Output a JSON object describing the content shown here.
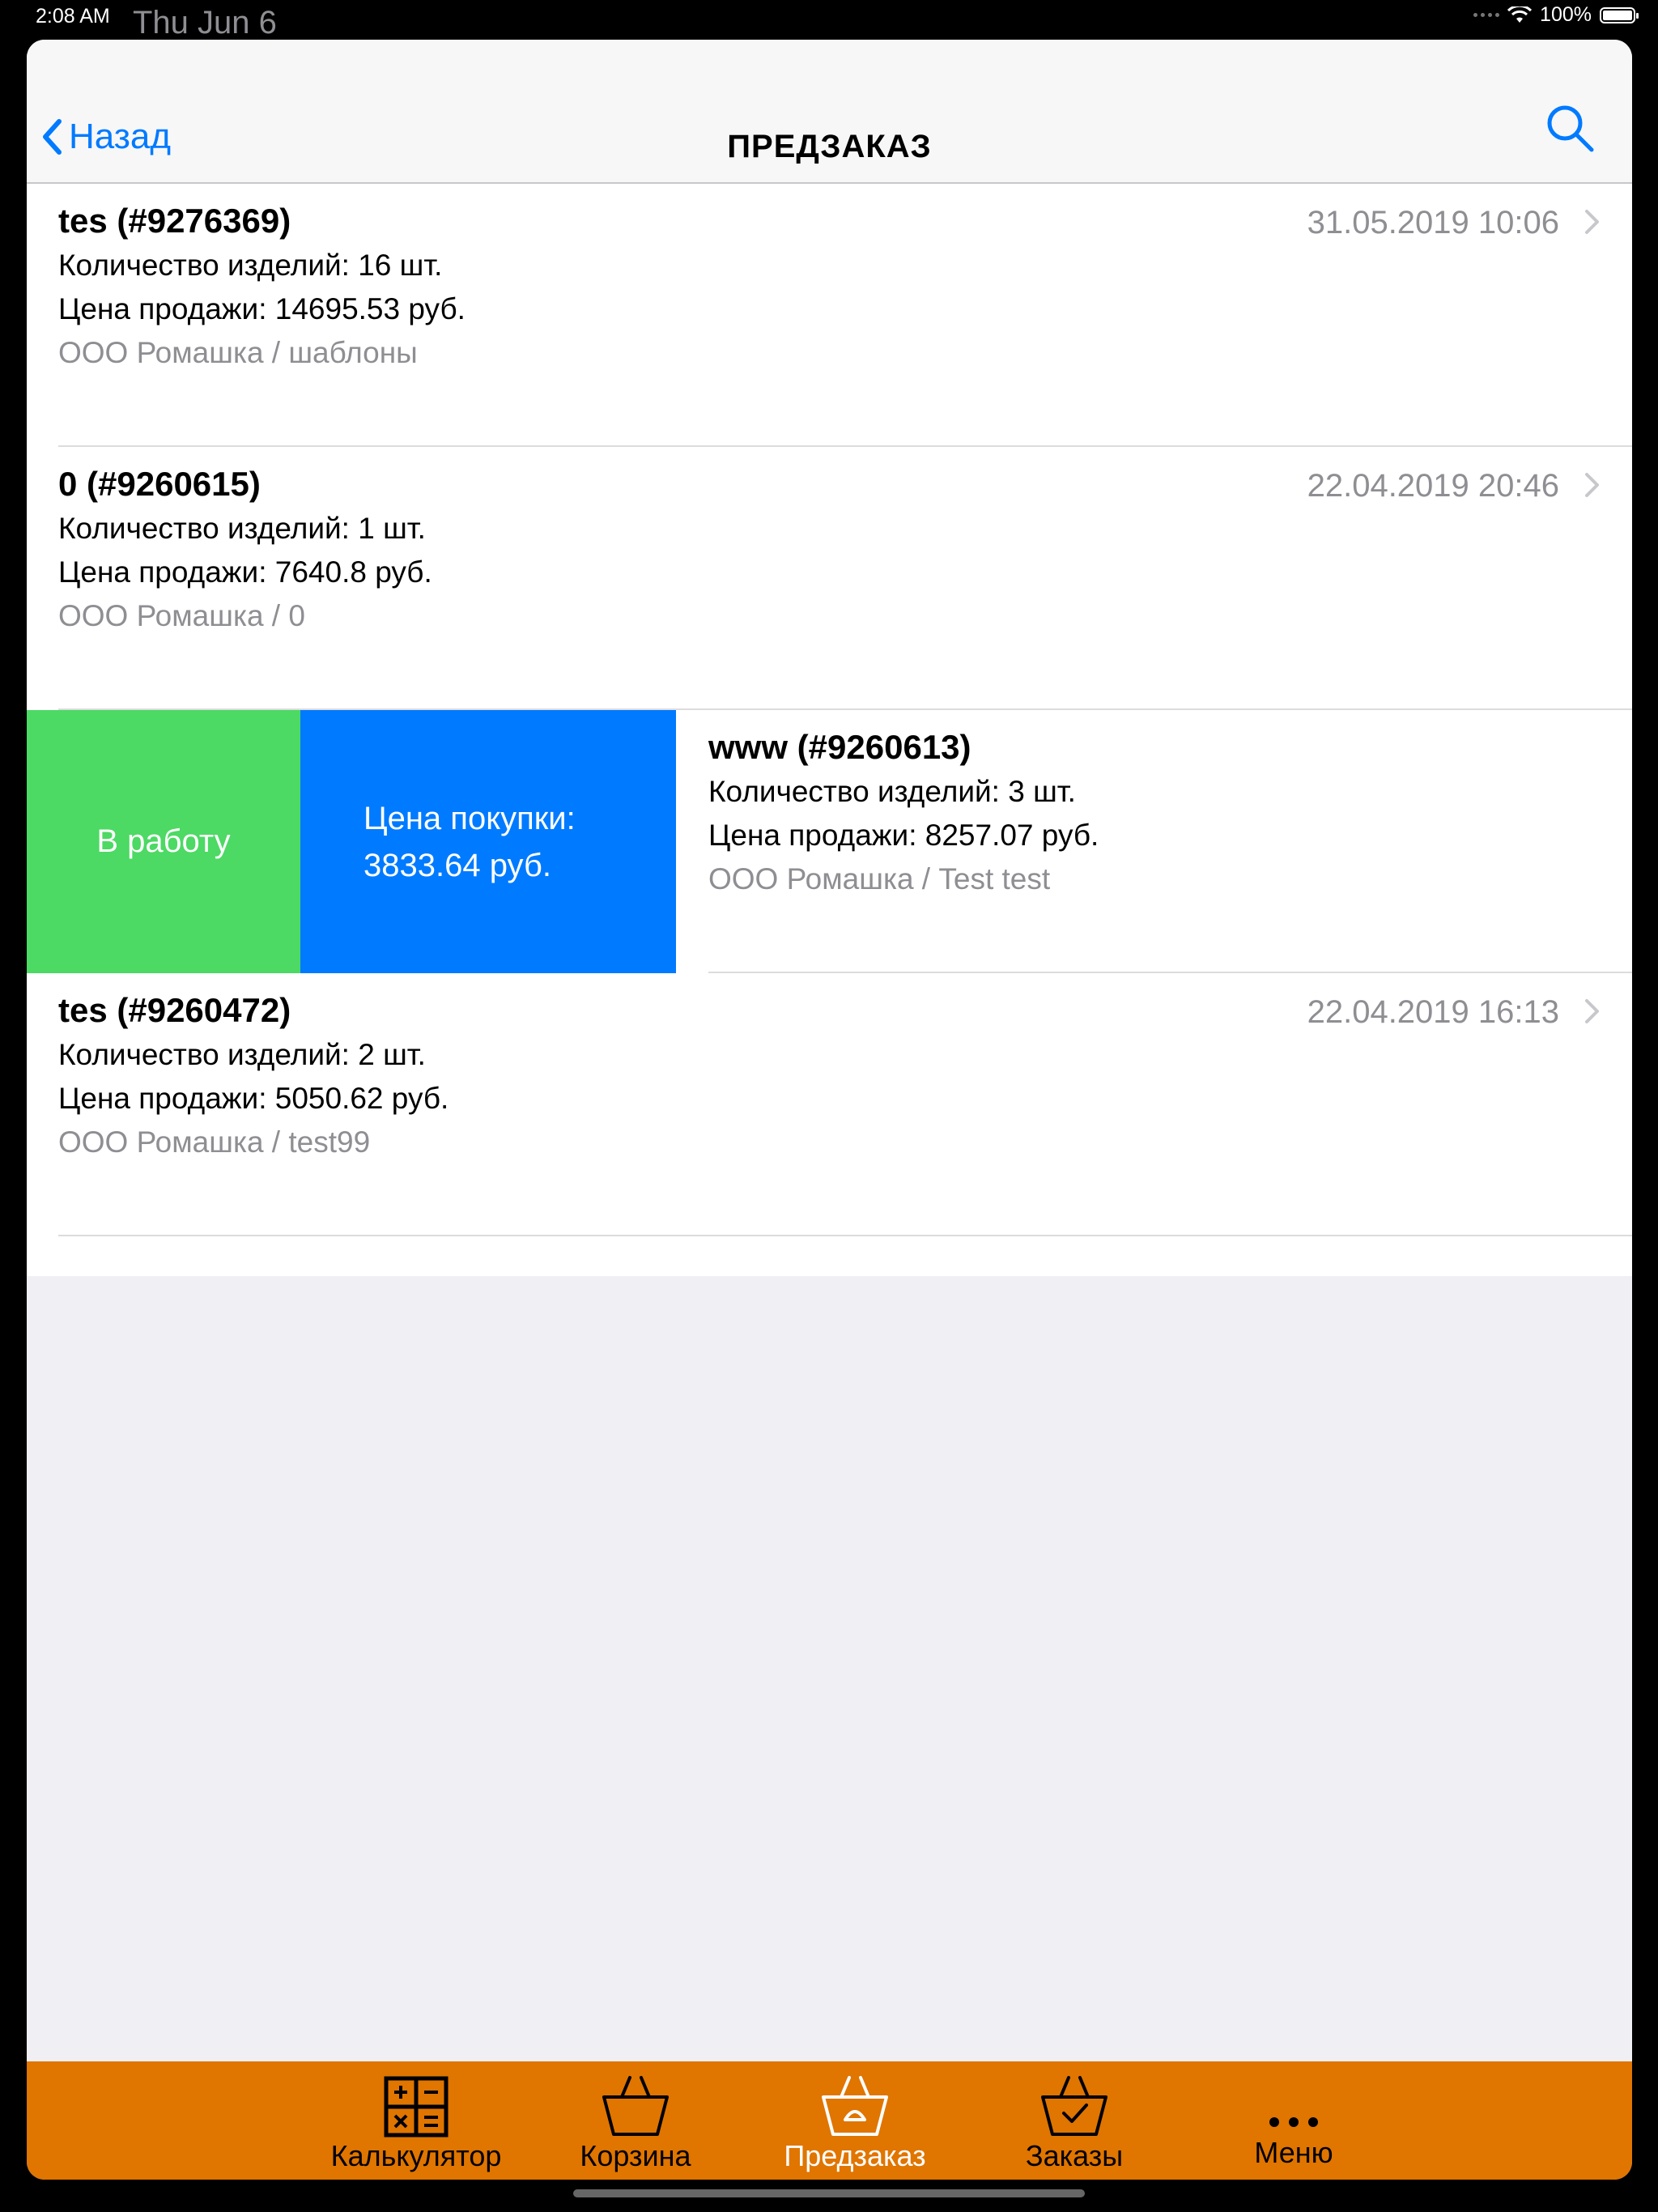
{
  "status_bar": {
    "time": "2:08 AM",
    "date": "Thu Jun 6",
    "battery": "100%"
  },
  "nav": {
    "back_label": "Назад",
    "title": "ПРЕДЗАКАЗ"
  },
  "orders": [
    {
      "title": "tes (#9276369)",
      "date": "31.05.2019 10:06",
      "qty": "Количество изделий: 16 шт.",
      "price": "Цена продажи: 14695.53 руб.",
      "org": "ООО Ромашка / шаблоны"
    },
    {
      "title": "0 (#9260615)",
      "date": "22.04.2019 20:46",
      "qty": "Количество изделий: 1 шт.",
      "price": "Цена продажи: 7640.8 руб.",
      "org": "ООО Ромашка / 0"
    },
    {
      "title": "www (#9260613)",
      "qty": "Количество изделий: 3 шт.",
      "price": "Цена продажи: 8257.07 руб.",
      "org": "ООО Ромашка / Test test",
      "swipe_action": "В работу",
      "purchase_label": "Цена покупки:",
      "purchase_value": "3833.64 руб."
    },
    {
      "title": "tes (#9260472)",
      "date": "22.04.2019 16:13",
      "qty": "Количество изделий: 2 шт.",
      "price": "Цена продажи: 5050.62 руб.",
      "org": "ООО Ромашка / test99"
    }
  ],
  "tabs": [
    {
      "label": "Калькулятор",
      "icon": "calculator-icon",
      "active": false
    },
    {
      "label": "Корзина",
      "icon": "basket-icon",
      "active": false
    },
    {
      "label": "Предзаказ",
      "icon": "preorder-basket-icon",
      "active": true
    },
    {
      "label": "Заказы",
      "icon": "orders-basket-check-icon",
      "active": false
    },
    {
      "label": "Меню",
      "icon": "more-icon",
      "active": false
    }
  ],
  "colors": {
    "accent": "#007aff",
    "tabbar": "#e07500",
    "swipe_green": "#4cd964",
    "swipe_blue": "#007aff",
    "secondary_text": "#8e8e93"
  }
}
